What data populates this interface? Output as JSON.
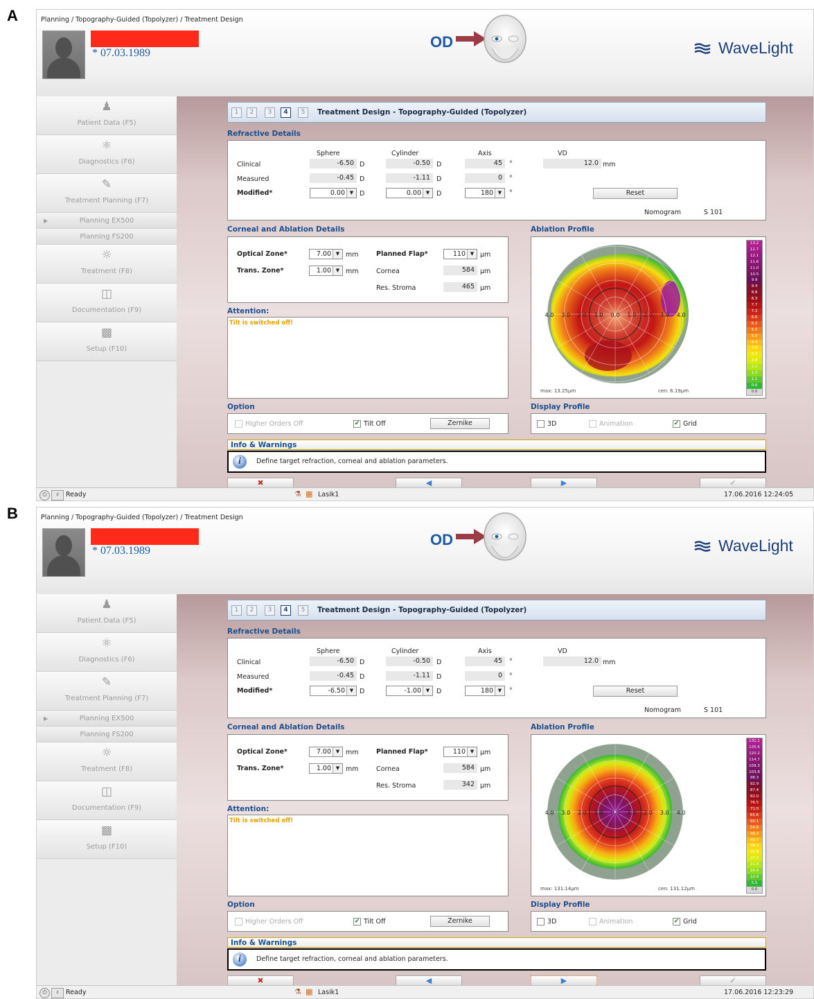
{
  "panels": [
    {
      "letter": "A",
      "breadcrumb": "Planning / Topography-Guided (Topolyzer) / Treatment Design",
      "dob": "* 07.03.1989",
      "eye": "OD",
      "brand": "WaveLight",
      "nav": {
        "patient": "Patient Data (F5)",
        "diagnostics": "Diagnostics (F6)",
        "treatment_planning": "Treatment Planning (F7)",
        "planning_ex500": "Planning EX500",
        "planning_fs200": "Planning FS200",
        "treatment": "Treatment (F8)",
        "documentation": "Documentation (F9)",
        "setup": "Setup (F10)"
      },
      "steps": [
        "1",
        "2",
        "3",
        "4",
        "5"
      ],
      "active_step": "4",
      "title": "Treatment Design - Topography-Guided (Topolyzer)",
      "refractive": {
        "heading": "Refractive Details",
        "col_sphere": "Sphere",
        "col_cylinder": "Cylinder",
        "col_axis": "Axis",
        "col_vd": "VD",
        "row_clinical": "Clinical",
        "row_measured": "Measured",
        "row_modified": "Modified*",
        "clinical_sphere": "-6.50",
        "clinical_cylinder": "-0.50",
        "clinical_axis": "45",
        "measured_sphere": "-0.45",
        "measured_cylinder": "-1.11",
        "measured_axis": "0",
        "modified_sphere": "0.00",
        "modified_cylinder": "0.00",
        "modified_axis": "180",
        "vd": "12.0",
        "unit_d": "D",
        "unit_deg": "°",
        "unit_mm": "mm",
        "reset": "Reset",
        "nomogram_label": "Nomogram",
        "nomogram_value": "S 101"
      },
      "corneal": {
        "heading": "Corneal and Ablation Details",
        "optical_zone_label": "Optical Zone*",
        "optical_zone": "7.00",
        "trans_zone_label": "Trans. Zone*",
        "trans_zone": "1.00",
        "planned_flap_label": "Planned Flap*",
        "planned_flap": "110",
        "cornea_label": "Cornea",
        "cornea": "584",
        "res_stroma_label": "Res. Stroma",
        "res_stroma": "465",
        "unit_mm": "mm",
        "unit_um": "µm"
      },
      "attention": {
        "heading": "Attention:",
        "text": "Tilt is switched off!"
      },
      "ablation": {
        "heading": "Ablation Profile",
        "axis_labels": [
          "4.0",
          "3.0",
          "2.0",
          "1.0",
          "0.0",
          "1.0",
          "2.0",
          "3.0",
          "4.0"
        ],
        "max": "max: 13.25µm",
        "cen": "cen: 6.19µm",
        "scale": [
          "13.2",
          "12.7",
          "12.1",
          "11.6",
          "11.0",
          "10.5",
          "9.9",
          "9.4",
          "8.8",
          "8.3",
          "7.7",
          "7.2",
          "6.6",
          "6.1",
          "5.5",
          "5.0",
          "4.4",
          "3.9",
          "3.3",
          "2.8",
          "2.2",
          "1.7",
          "1.1",
          "0.6",
          "0.0"
        ],
        "pattern": "irregular"
      },
      "option": {
        "heading": "Option",
        "higher_orders": "Higher Orders Off",
        "higher_orders_checked": false,
        "tilt": "Tilt Off",
        "tilt_checked": true,
        "zernike": "Zernike"
      },
      "display": {
        "heading": "Display Profile",
        "three_d": "3D",
        "animation": "Animation",
        "grid": "Grid",
        "grid_checked": true
      },
      "info": {
        "heading": "Info & Warnings",
        "text": "Define target refraction, corneal and ablation parameters."
      },
      "buttons": {
        "cancel": "✖",
        "back": "◀",
        "next": "▶",
        "confirm": "✔",
        "next_focused": false
      },
      "status": {
        "ready": "Ready",
        "user": "Lasik1",
        "datetime": "17.06.2016 12:24:05"
      }
    },
    {
      "letter": "B",
      "breadcrumb": "Planning / Topography-Guided (Topolyzer) / Treatment Design",
      "dob": "* 07.03.1989",
      "eye": "OD",
      "brand": "WaveLight",
      "nav": {
        "patient": "Patient Data (F5)",
        "diagnostics": "Diagnostics (F6)",
        "treatment_planning": "Treatment Planning (F7)",
        "planning_ex500": "Planning EX500",
        "planning_fs200": "Planning FS200",
        "treatment": "Treatment (F8)",
        "documentation": "Documentation (F9)",
        "setup": "Setup (F10)"
      },
      "steps": [
        "1",
        "2",
        "3",
        "4",
        "5"
      ],
      "active_step": "4",
      "title": "Treatment Design - Topography-Guided (Topolyzer)",
      "refractive": {
        "heading": "Refractive Details",
        "col_sphere": "Sphere",
        "col_cylinder": "Cylinder",
        "col_axis": "Axis",
        "col_vd": "VD",
        "row_clinical": "Clinical",
        "row_measured": "Measured",
        "row_modified": "Modified*",
        "clinical_sphere": "-6.50",
        "clinical_cylinder": "-0.50",
        "clinical_axis": "45",
        "measured_sphere": "-0.45",
        "measured_cylinder": "-1.11",
        "measured_axis": "0",
        "modified_sphere": "-6.50",
        "modified_cylinder": "-1.00",
        "modified_axis": "180",
        "vd": "12.0",
        "unit_d": "D",
        "unit_deg": "°",
        "unit_mm": "mm",
        "reset": "Reset",
        "nomogram_label": "Nomogram",
        "nomogram_value": "S 101"
      },
      "corneal": {
        "heading": "Corneal and Ablation Details",
        "optical_zone_label": "Optical Zone*",
        "optical_zone": "7.00",
        "trans_zone_label": "Trans. Zone*",
        "trans_zone": "1.00",
        "planned_flap_label": "Planned Flap*",
        "planned_flap": "110",
        "cornea_label": "Cornea",
        "cornea": "584",
        "res_stroma_label": "Res. Stroma",
        "res_stroma": "342",
        "unit_mm": "mm",
        "unit_um": "µm"
      },
      "attention": {
        "heading": "Attention:",
        "text": "Tilt is switched off!"
      },
      "ablation": {
        "heading": "Ablation Profile",
        "axis_labels": [
          "4.0",
          "3.0",
          "2.0",
          "1.0",
          "0.0",
          "1.0",
          "2.0",
          "3.0",
          "4.0"
        ],
        "max": "max: 131.14µm",
        "cen": "cen: 131.12µm",
        "scale": [
          "131.1",
          "125.6",
          "120.2",
          "114.7",
          "109.3",
          "103.8",
          "98.3",
          "92.9",
          "87.4",
          "82.0",
          "76.5",
          "71.0",
          "65.6",
          "60.1",
          "54.6",
          "49.2",
          "43.7",
          "38.2",
          "32.8",
          "27.3",
          "21.9",
          "16.4",
          "10.9",
          "5.5",
          "0.0"
        ],
        "pattern": "symmetric"
      },
      "option": {
        "heading": "Option",
        "higher_orders": "Higher Orders Off",
        "higher_orders_checked": false,
        "tilt": "Tilt Off",
        "tilt_checked": true,
        "zernike": "Zernike"
      },
      "display": {
        "heading": "Display Profile",
        "three_d": "3D",
        "animation": "Animation",
        "grid": "Grid",
        "grid_checked": true
      },
      "info": {
        "heading": "Info & Warnings",
        "text": "Define target refraction, corneal and ablation parameters."
      },
      "buttons": {
        "cancel": "✖",
        "back": "◀",
        "next": "▶",
        "confirm": "✔",
        "next_focused": true
      },
      "status": {
        "ready": "Ready",
        "user": "Lasik1",
        "datetime": "17.06.2016 12:23:29"
      }
    }
  ],
  "colors": {
    "accent_blue": "#1c4f8c",
    "attention_text": "#e0a000",
    "redaction": "#ff2a1a",
    "brand": "#1c3f78",
    "main_bg": "#dcc9c9"
  }
}
